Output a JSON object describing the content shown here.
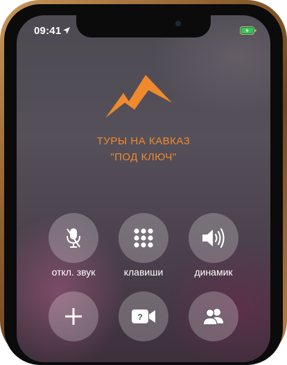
{
  "status_bar": {
    "time": "09:41",
    "location_icon": "location-arrow-icon",
    "battery_icon": "battery-charging-icon"
  },
  "brand": {
    "logo_icon": "mountain-logo-icon",
    "line1": "ТУРЫ НА КАВКАЗ",
    "line2": "\"ПОД КЛЮЧ\"",
    "accent_color": "#f08a2c"
  },
  "call_controls": {
    "row1": [
      {
        "icon": "microphone-muted-icon",
        "label": "откл. звук"
      },
      {
        "icon": "keypad-icon",
        "label": "клавиши"
      },
      {
        "icon": "speaker-icon",
        "label": "динамик"
      }
    ],
    "row2": [
      {
        "icon": "plus-icon"
      },
      {
        "icon": "facetime-video-icon"
      },
      {
        "icon": "contacts-icon"
      }
    ]
  }
}
